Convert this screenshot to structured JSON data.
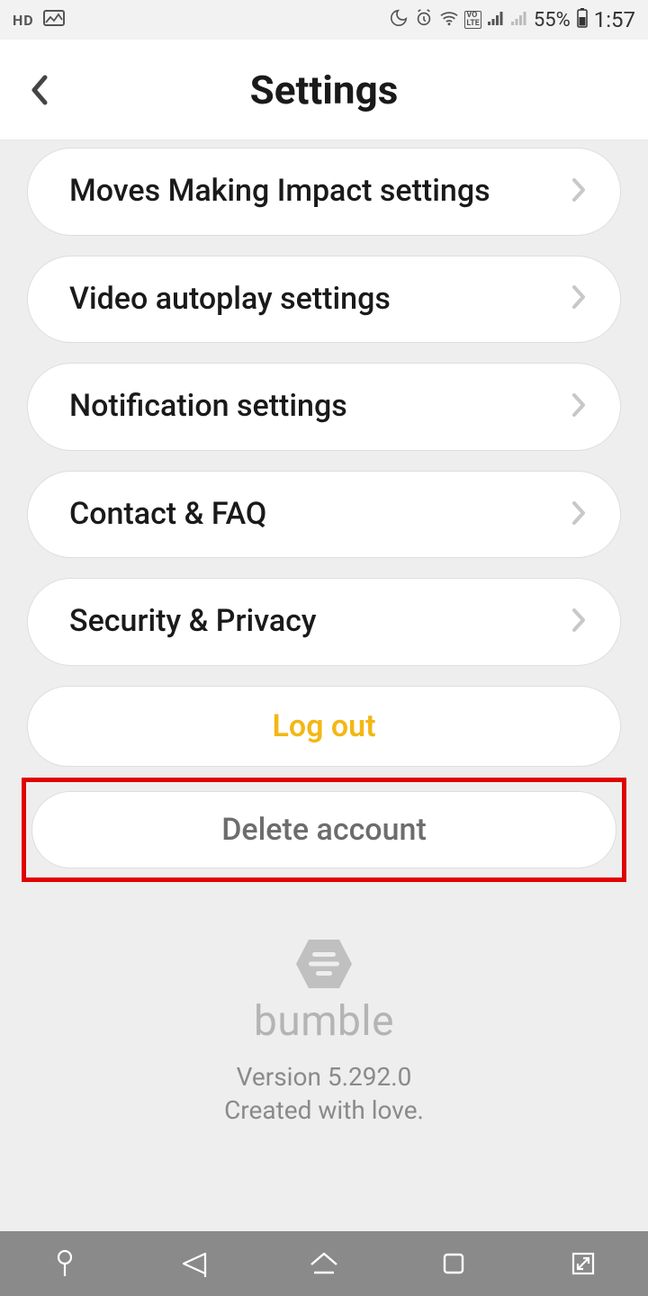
{
  "statusbar": {
    "hd": "HD",
    "battery_text": "55%",
    "time": "1:57"
  },
  "header": {
    "title": "Settings"
  },
  "settings": {
    "items": [
      {
        "label": "Moves Making Impact settings"
      },
      {
        "label": "Video autoplay settings"
      },
      {
        "label": "Notification settings"
      },
      {
        "label": "Contact & FAQ"
      },
      {
        "label": "Security & Privacy"
      }
    ],
    "logout_label": "Log out",
    "delete_label": "Delete account"
  },
  "brand": {
    "name": "bumble",
    "version": "Version 5.292.0",
    "tagline": "Created with love."
  }
}
